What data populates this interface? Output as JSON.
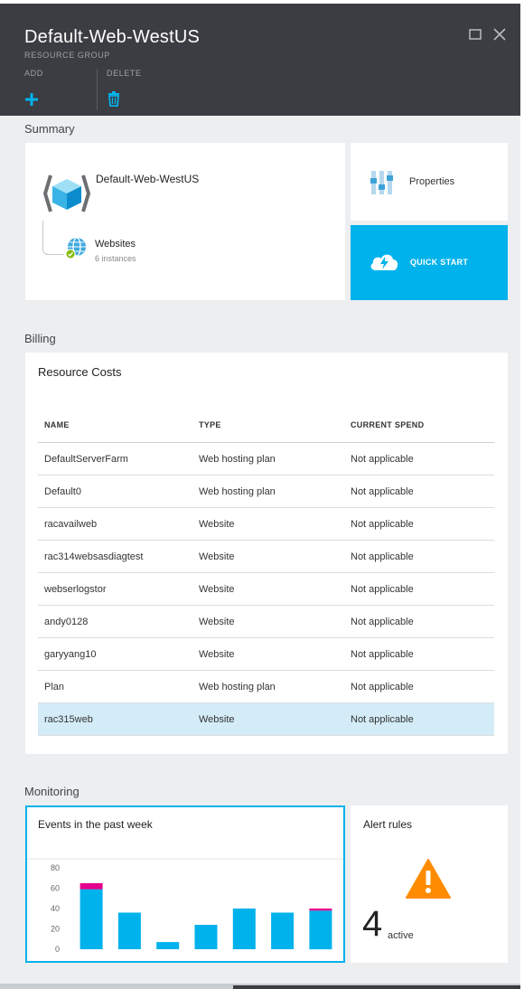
{
  "header": {
    "title": "Default-Web-WestUS",
    "subtitle": "RESOURCE GROUP",
    "commands": {
      "add_label": "ADD",
      "delete_label": "DELETE"
    }
  },
  "summary": {
    "section_label": "Summary",
    "resource_group_name": "Default-Web-WestUS",
    "websites": {
      "label": "Websites",
      "count": "6 instances"
    },
    "properties_label": "Properties",
    "quick_start_label": "QUICK START"
  },
  "billing": {
    "section_label": "Billing",
    "card_title": "Resource Costs",
    "columns": [
      "NAME",
      "TYPE",
      "CURRENT SPEND"
    ],
    "rows": [
      {
        "name": "DefaultServerFarm",
        "type": "Web hosting plan",
        "spend": "Not applicable"
      },
      {
        "name": "Default0",
        "type": "Web hosting plan",
        "spend": "Not applicable"
      },
      {
        "name": "racavailweb",
        "type": "Website",
        "spend": "Not applicable"
      },
      {
        "name": "rac314websasdiagtest",
        "type": "Website",
        "spend": "Not applicable"
      },
      {
        "name": "webserlogstor",
        "type": "Website",
        "spend": "Not applicable"
      },
      {
        "name": "andy0128",
        "type": "Website",
        "spend": "Not applicable"
      },
      {
        "name": "garyyang10",
        "type": "Website",
        "spend": "Not applicable"
      },
      {
        "name": "Plan",
        "type": "Web hosting plan",
        "spend": "Not applicable"
      },
      {
        "name": "rac315web",
        "type": "Website",
        "spend": "Not applicable"
      }
    ],
    "selected_row": 8
  },
  "monitoring": {
    "section_label": "Monitoring",
    "events_title": "Events in the past week",
    "alerts_title": "Alert rules",
    "alerts_count": "4",
    "alerts_suffix": "active"
  },
  "chart_data": {
    "type": "bar",
    "title": "Events in the past week",
    "categories": [
      "",
      "",
      "",
      "",
      "",
      "",
      ""
    ],
    "series": [
      {
        "values": [
          59,
          36,
          7,
          24,
          40,
          36,
          38
        ],
        "color": "#00b2ec"
      },
      {
        "values": [
          6,
          0,
          0,
          0,
          0,
          0,
          2
        ],
        "color": "#e3008c"
      }
    ],
    "yticks": [
      "0",
      "20",
      "40",
      "60",
      "80"
    ],
    "ylim": [
      0,
      80
    ],
    "stacked": true,
    "grid": false
  },
  "colors": {
    "accent": "#00b2ec",
    "header_bg": "#3c3d42",
    "alert": "#ff8c00",
    "selected_row": "#d4ecf7",
    "success": "#7fba00"
  },
  "icons": {
    "add": "plus-icon",
    "delete": "trash-icon",
    "maximize": "maximize-icon",
    "close": "close-icon",
    "resource_group": "resource-group-cube-icon",
    "websites": "globe-icon",
    "properties": "properties-sliders-icon",
    "quick_start": "cloud-lightning-icon",
    "alert": "warning-triangle-icon"
  }
}
